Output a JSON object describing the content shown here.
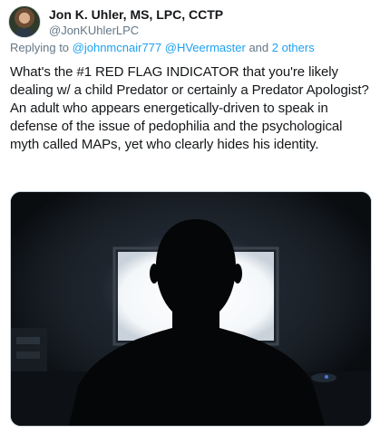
{
  "tweet": {
    "author_name": "Jon K. Uhler, MS, LPC, CCTP",
    "author_handle": "@JonKUhlerLPC",
    "reply_prefix": "Replying to ",
    "reply_mention_1": "@johnmcnair777",
    "reply_mention_2": "@HVeermaster",
    "reply_and": " and ",
    "reply_others": "2 others",
    "text": "What's the #1 RED FLAG INDICATOR that you're likely dealing w/ a child Predator or certainly a Predator Apologist? An adult who appears energetically-driven to speak in defense of the issue of pedophilia and the psychological myth called MAPs, yet who clearly hides his identity."
  },
  "colors": {
    "link": "#1da1f2",
    "secondary_text": "#657786",
    "primary_text": "#14171a"
  },
  "icons": {
    "avatar": "profile-photo"
  }
}
